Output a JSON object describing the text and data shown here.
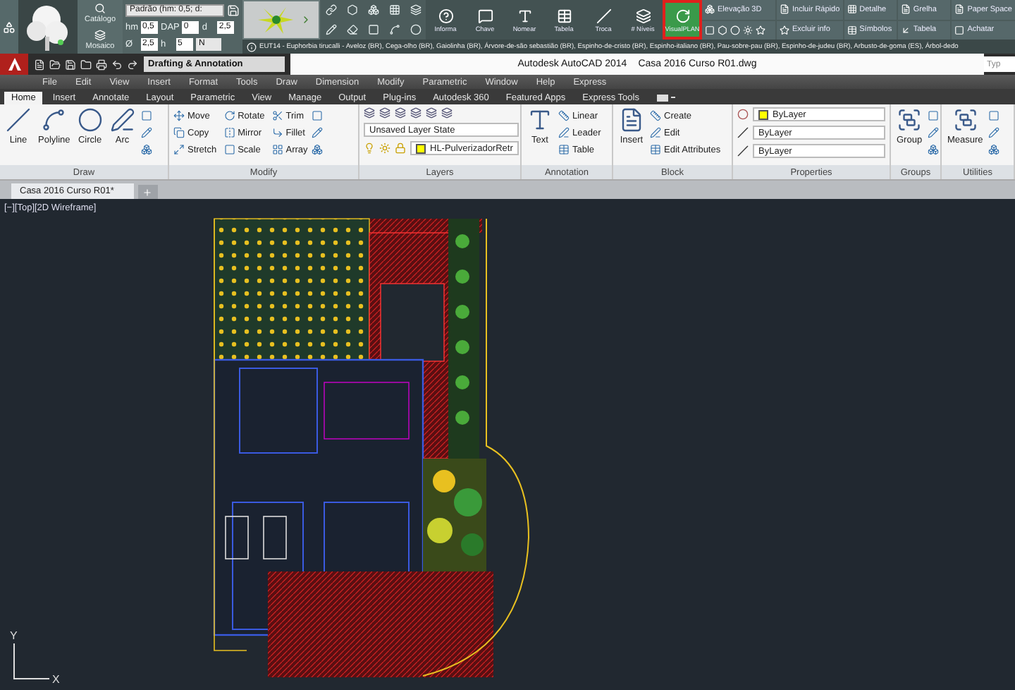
{
  "plugin_toolbar": {
    "side_buttons": [
      "Catálogo",
      "Mosaico"
    ],
    "preset": "Padrão (hm: 0,5; d:",
    "params_row_1": [
      {
        "label": "hm",
        "value": "0,5"
      },
      {
        "label": "DAP",
        "value": "0"
      },
      {
        "label": "d",
        "value": "2,5"
      }
    ],
    "params_row_2": [
      {
        "label": "Ø",
        "value": "2,5"
      },
      {
        "label": "h",
        "value": "5"
      }
    ],
    "n_select": "N",
    "tools": [
      {
        "label": "Informa",
        "selected": false
      },
      {
        "label": "Chave",
        "selected": false
      },
      {
        "label": "Nomear",
        "selected": false
      },
      {
        "label": "Tabela",
        "selected": false
      },
      {
        "label": "Troca",
        "selected": false
      },
      {
        "label": "# Níveis",
        "selected": false
      },
      {
        "label": "VisualPLAN",
        "selected": true
      }
    ],
    "right_tools": [
      "Elevação 3D",
      "Incluir Rápido",
      "Detalhe",
      "Grelha",
      "Paper Space",
      "Excluir info",
      "Símbolos",
      "Tabela",
      "Achatar"
    ],
    "info_text": "EUT14 - Euphorbia tirucalli - Aveloz (BR), Cega-olho (BR), Gaiolinha (BR), Árvore-de-são sebastião (BR), Espinho-de-cristo (BR), Espinho-italiano (BR), Pau-sobre-pau (BR), Espinho-de-judeu (BR), Arbusto-de-goma (ES), Árbol-dedo"
  },
  "title_bar": {
    "workspace": "Drafting & Annotation",
    "app": "Autodesk AutoCAD 2014",
    "file": "Casa 2016 Curso R01.dwg",
    "search_placeholder": "Typ"
  },
  "menu": [
    "File",
    "Edit",
    "View",
    "Insert",
    "Format",
    "Tools",
    "Draw",
    "Dimension",
    "Modify",
    "Parametric",
    "Window",
    "Help",
    "Express"
  ],
  "ribbon_tabs": [
    {
      "label": "Home",
      "selected": true
    },
    {
      "label": "Insert",
      "selected": false
    },
    {
      "label": "Annotate",
      "selected": false
    },
    {
      "label": "Layout",
      "selected": false
    },
    {
      "label": "Parametric",
      "selected": false
    },
    {
      "label": "View",
      "selected": false
    },
    {
      "label": "Manage",
      "selected": false
    },
    {
      "label": "Output",
      "selected": false
    },
    {
      "label": "Plug-ins",
      "selected": false
    },
    {
      "label": "Autodesk 360",
      "selected": false
    },
    {
      "label": "Featured Apps",
      "selected": false
    },
    {
      "label": "Express Tools",
      "selected": false
    }
  ],
  "ribbon_panels": [
    {
      "kind": "tools",
      "title": "Draw",
      "large": [
        "Line",
        "Polyline",
        "Circle",
        "Arc"
      ],
      "icon_column": true
    },
    {
      "kind": "tools",
      "title": "Modify",
      "small": [
        "Move",
        "Copy",
        "Stretch",
        "Rotate",
        "Mirror",
        "Scale",
        "Trim",
        "Fillet",
        "Array"
      ],
      "icon_column": true
    },
    {
      "kind": "layers",
      "title": "Layers",
      "layer_state": "Unsaved Layer State",
      "current_layer": "HL-PulverizadorRetr",
      "color": "#ffff00"
    },
    {
      "kind": "tools",
      "title": "Annotation",
      "large": [
        "Text"
      ],
      "small": [
        "Linear",
        "Leader",
        "Table"
      ],
      "icon_column": false
    },
    {
      "kind": "tools",
      "title": "Block",
      "large": [
        "Insert"
      ],
      "small": [
        "Create",
        "Edit",
        "Edit Attributes"
      ],
      "icon_column": false
    },
    {
      "kind": "properties",
      "title": "Properties",
      "color_value": "ByLayer",
      "linetype": "ByLayer",
      "lineweight": "ByLayer",
      "color": "#ffff00"
    },
    {
      "kind": "tools",
      "title": "Groups",
      "large": [
        "Group"
      ],
      "icon_column": true
    },
    {
      "kind": "tools",
      "title": "Utilities",
      "large": [
        "Measure"
      ],
      "icon_column": true
    }
  ],
  "file_tabs": [
    {
      "label": "Casa 2016 Curso R01*",
      "selected": true
    }
  ],
  "viewport": {
    "label": "[−][Top][2D Wireframe]",
    "ucs_x": "X",
    "ucs_y": "Y"
  }
}
